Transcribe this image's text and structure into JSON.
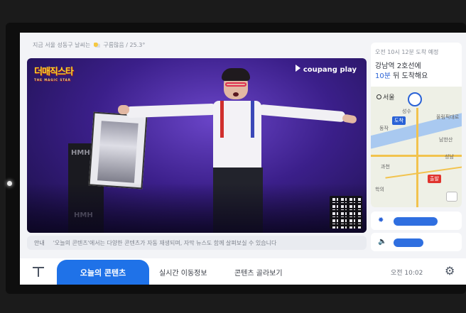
{
  "top_bar": {
    "weather_prefix": "지금 서울 성동구 날씨는",
    "weather_suffix": "구름많음 / 25.3°",
    "weather_icon": "partly-cloudy-icon"
  },
  "video": {
    "show_logo": "더매직스타",
    "show_logo_sub": "THE MAGIC STAR",
    "provider": "coupang play",
    "box_label": "HMH",
    "qr_icon": "qr-code-icon"
  },
  "notice": {
    "tag": "안내",
    "text": "'오늘의 콘텐츠'에서는 다양한 콘텐츠가 자동 재생되며, 자막 뉴스도 함께 살펴보실 수 있습니다"
  },
  "transit": {
    "status": "오전 10시 12분 도착 예정",
    "line1": "강남역 2호선에",
    "minutes": "10분",
    "line2_suffix": " 뒤 도착해요",
    "map": {
      "city": "서울",
      "destination_label": "도착",
      "origin_label": "출발",
      "labels": [
        "성수",
        "동작",
        "과천",
        "남한산",
        "성남",
        "올림픽대로",
        "학의"
      ]
    }
  },
  "controls": {
    "brightness_icon": "sun-icon",
    "volume_icon": "speaker-icon",
    "brightness_level": 1.0,
    "volume_level": 1.0
  },
  "bottom_nav": {
    "tabs": [
      {
        "label": "오늘의 콘텐츠",
        "active": true
      },
      {
        "label": "실시간 이동정보",
        "active": false
      },
      {
        "label": "콘텐츠 골라보기",
        "active": false
      }
    ],
    "clock": "오전 10:02",
    "settings_icon": "gear-icon"
  },
  "colors": {
    "accent": "#1f72e8",
    "background": "#f3f4f7"
  }
}
